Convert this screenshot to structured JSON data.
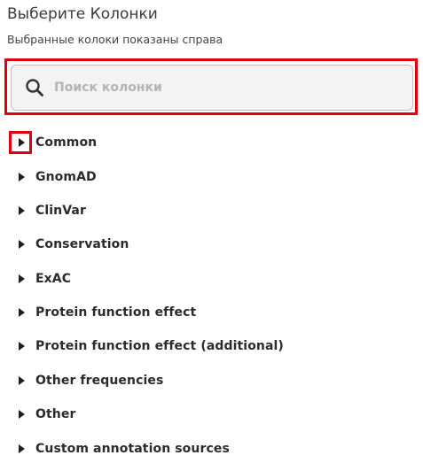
{
  "header": {
    "title": "Выберите Колонки",
    "subtitle": "Выбранные колоки показаны справа"
  },
  "search": {
    "placeholder": "Поиск колонки",
    "value": "",
    "icon": "search-icon"
  },
  "colors": {
    "highlight": "#e0000f",
    "search_bg": "#f3f3f3",
    "text": "#2b2b2b",
    "placeholder": "#b4b4b4"
  },
  "groups": [
    {
      "label": "Common",
      "expanded": false
    },
    {
      "label": "GnomAD",
      "expanded": false
    },
    {
      "label": "ClinVar",
      "expanded": false
    },
    {
      "label": "Conservation",
      "expanded": false
    },
    {
      "label": "ExAC",
      "expanded": false
    },
    {
      "label": "Protein function effect",
      "expanded": false
    },
    {
      "label": "Protein function effect (additional)",
      "expanded": false
    },
    {
      "label": "Other frequencies",
      "expanded": false
    },
    {
      "label": "Other",
      "expanded": false
    },
    {
      "label": "Custom annotation sources",
      "expanded": false
    }
  ]
}
